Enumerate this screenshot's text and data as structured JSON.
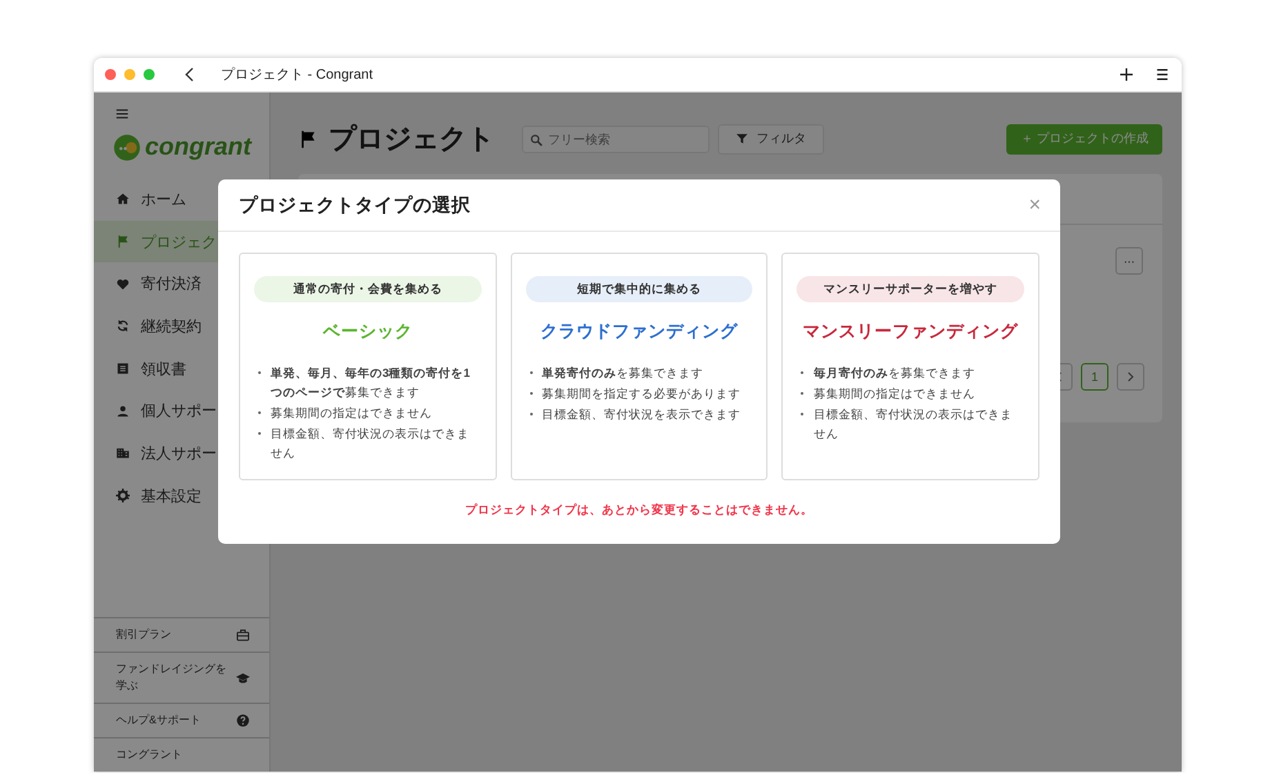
{
  "window": {
    "title": "プロジェクト - Congrant"
  },
  "sidebar": {
    "logo": "congrant",
    "items": [
      {
        "label": "ホーム",
        "selected": false
      },
      {
        "label": "プロジェク",
        "selected": true
      },
      {
        "label": "寄付決済",
        "selected": false
      },
      {
        "label": "継続契約",
        "selected": false
      },
      {
        "label": "領収書",
        "selected": false
      },
      {
        "label": "個人サポー",
        "selected": false
      },
      {
        "label": "法人サポー",
        "selected": false
      },
      {
        "label": "基本設定",
        "selected": false
      }
    ],
    "footer": [
      {
        "label": "割引プラン"
      },
      {
        "label": "ファンドレイジングを学ぶ"
      },
      {
        "label": "ヘルプ&サポート"
      },
      {
        "label": "コングラント"
      }
    ]
  },
  "header": {
    "title": "プロジェクト",
    "search": {
      "placeholder": "フリー検索"
    },
    "filter": "フィルタ",
    "create": "＋ プロジェクトの作成"
  },
  "list": {
    "more": "···",
    "page": "1"
  },
  "modal": {
    "title": "プロジェクトタイプの選択",
    "close": "×",
    "types": [
      {
        "tag": "通常の寄付・会費を集める",
        "name": "ベーシック",
        "color": "#5cb531",
        "points": [
          "**単発、毎月、毎年の3種類の寄付を1つのページで**募集できます",
          "募集期間の指定はできません",
          "目標金額、寄付状況の表示はできません"
        ]
      },
      {
        "tag": "短期で集中的に集める",
        "name": "クラウドファンディング",
        "color": "#2d6fd0",
        "points": [
          "**単発寄付のみ**を募集できます",
          "募集期間を指定する必要があります",
          "目標金額、寄付状況を表示できます"
        ]
      },
      {
        "tag": "マンスリーサポーターを増やす",
        "name": "マンスリーファンディング",
        "color": "#c8283c",
        "points": [
          "**毎月寄付のみ**を募集できます",
          "募集期間の指定はできません",
          "目標金額、寄付状況の表示はできません"
        ]
      }
    ],
    "note": "プロジェクトタイプは、あとから変更することはできません。"
  }
}
